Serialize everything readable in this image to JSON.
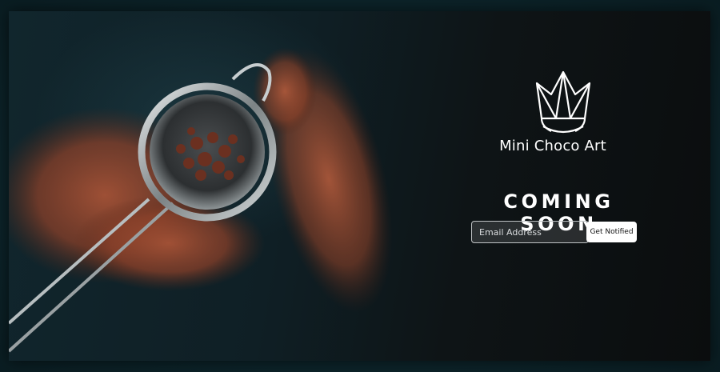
{
  "brand": {
    "name": "Mini Choco Art",
    "logo_icon": "crown-icon"
  },
  "hero": {
    "headline": "COMING SOON",
    "image_icon": "cocoa-sieve-photo"
  },
  "signup": {
    "email_placeholder": "Email Address",
    "email_value": "",
    "button_label": "Get Notified"
  },
  "colors": {
    "background": "#0f2a30",
    "text": "#ffffff",
    "cocoa": "#9a4a32",
    "button": "#ffffff"
  }
}
